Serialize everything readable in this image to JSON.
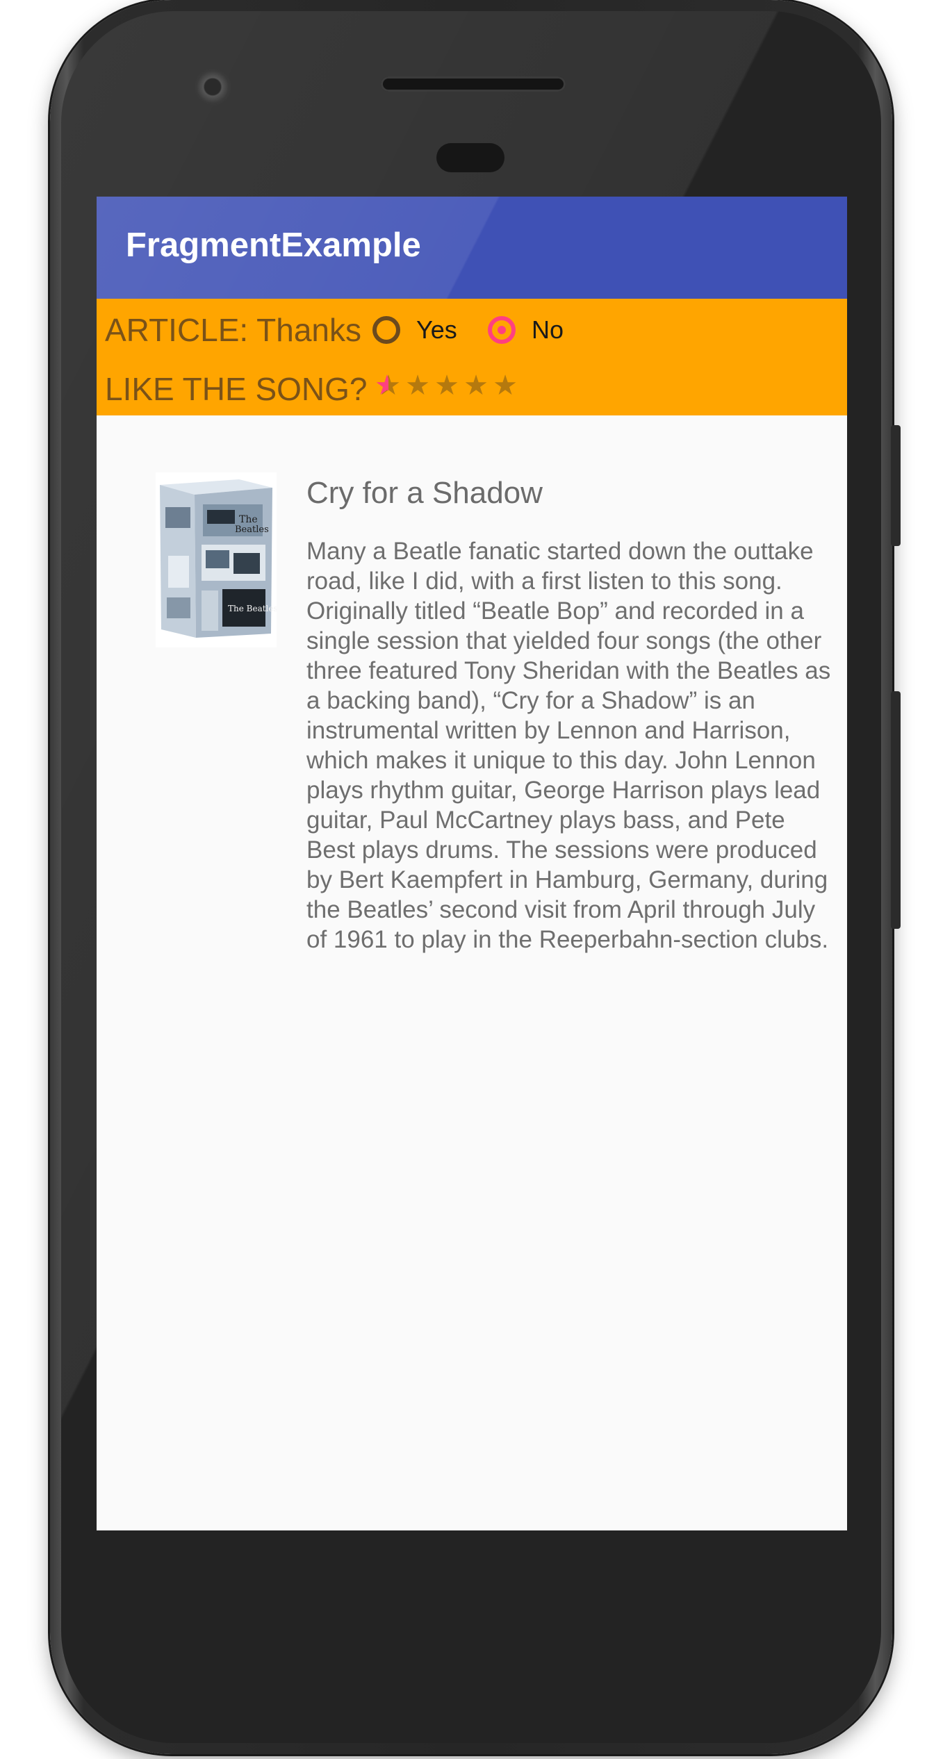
{
  "app_bar": {
    "title": "FragmentExample"
  },
  "header_fragment": {
    "article_label": "ARTICLE: Thanks",
    "radio_options": [
      {
        "label": "Yes",
        "selected": false
      },
      {
        "label": "No",
        "selected": true
      }
    ],
    "rating_label": "LIKE THE SONG?",
    "rating": {
      "value": 0.5,
      "max": 5
    }
  },
  "article": {
    "title": "Cry for a Shadow",
    "body": "Many a Beatle fanatic started down the outtake road, like I did, with a first listen to this song. Originally titled “Beatle Bop” and recorded in a single session that yielded four songs (the other three featured Tony Sheridan with the Beatles as a backing band), “Cry for a Shadow” is an instrumental written by Lennon and Harrison, which makes it unique to this day. John Lennon plays rhythm guitar, George Harrison plays lead guitar, Paul McCartney plays bass, and Pete Best plays drums. The sessions were produced by Bert Kaempfert in Hamburg, Germany, during the Beatles’ second visit from April through July of 1961 to play in the Reeperbahn-section clubs."
  },
  "colors": {
    "app_bar": "#3f51b5",
    "header_background": "#ffa500",
    "accent": "#ff4081",
    "screen_background": "#fafafa"
  },
  "icons": [
    "album-art-image",
    "star-icon",
    "radio-button-icon"
  ]
}
